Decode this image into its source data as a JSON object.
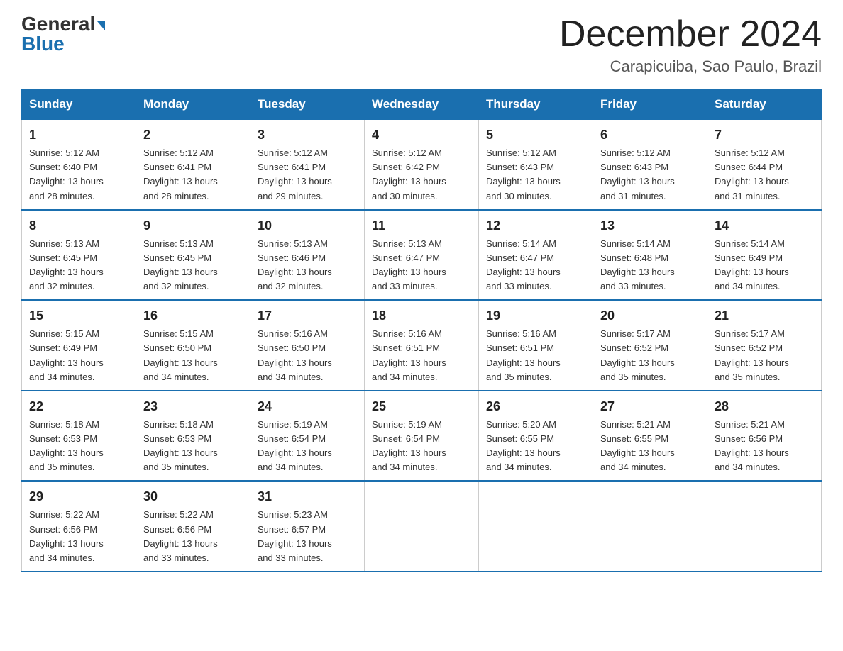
{
  "header": {
    "logo_general": "General",
    "logo_blue": "Blue",
    "title": "December 2024",
    "subtitle": "Carapicuiba, Sao Paulo, Brazil"
  },
  "weekdays": [
    "Sunday",
    "Monday",
    "Tuesday",
    "Wednesday",
    "Thursday",
    "Friday",
    "Saturday"
  ],
  "weeks": [
    [
      {
        "day": "1",
        "info": "Sunrise: 5:12 AM\nSunset: 6:40 PM\nDaylight: 13 hours\nand 28 minutes."
      },
      {
        "day": "2",
        "info": "Sunrise: 5:12 AM\nSunset: 6:41 PM\nDaylight: 13 hours\nand 28 minutes."
      },
      {
        "day": "3",
        "info": "Sunrise: 5:12 AM\nSunset: 6:41 PM\nDaylight: 13 hours\nand 29 minutes."
      },
      {
        "day": "4",
        "info": "Sunrise: 5:12 AM\nSunset: 6:42 PM\nDaylight: 13 hours\nand 30 minutes."
      },
      {
        "day": "5",
        "info": "Sunrise: 5:12 AM\nSunset: 6:43 PM\nDaylight: 13 hours\nand 30 minutes."
      },
      {
        "day": "6",
        "info": "Sunrise: 5:12 AM\nSunset: 6:43 PM\nDaylight: 13 hours\nand 31 minutes."
      },
      {
        "day": "7",
        "info": "Sunrise: 5:12 AM\nSunset: 6:44 PM\nDaylight: 13 hours\nand 31 minutes."
      }
    ],
    [
      {
        "day": "8",
        "info": "Sunrise: 5:13 AM\nSunset: 6:45 PM\nDaylight: 13 hours\nand 32 minutes."
      },
      {
        "day": "9",
        "info": "Sunrise: 5:13 AM\nSunset: 6:45 PM\nDaylight: 13 hours\nand 32 minutes."
      },
      {
        "day": "10",
        "info": "Sunrise: 5:13 AM\nSunset: 6:46 PM\nDaylight: 13 hours\nand 32 minutes."
      },
      {
        "day": "11",
        "info": "Sunrise: 5:13 AM\nSunset: 6:47 PM\nDaylight: 13 hours\nand 33 minutes."
      },
      {
        "day": "12",
        "info": "Sunrise: 5:14 AM\nSunset: 6:47 PM\nDaylight: 13 hours\nand 33 minutes."
      },
      {
        "day": "13",
        "info": "Sunrise: 5:14 AM\nSunset: 6:48 PM\nDaylight: 13 hours\nand 33 minutes."
      },
      {
        "day": "14",
        "info": "Sunrise: 5:14 AM\nSunset: 6:49 PM\nDaylight: 13 hours\nand 34 minutes."
      }
    ],
    [
      {
        "day": "15",
        "info": "Sunrise: 5:15 AM\nSunset: 6:49 PM\nDaylight: 13 hours\nand 34 minutes."
      },
      {
        "day": "16",
        "info": "Sunrise: 5:15 AM\nSunset: 6:50 PM\nDaylight: 13 hours\nand 34 minutes."
      },
      {
        "day": "17",
        "info": "Sunrise: 5:16 AM\nSunset: 6:50 PM\nDaylight: 13 hours\nand 34 minutes."
      },
      {
        "day": "18",
        "info": "Sunrise: 5:16 AM\nSunset: 6:51 PM\nDaylight: 13 hours\nand 34 minutes."
      },
      {
        "day": "19",
        "info": "Sunrise: 5:16 AM\nSunset: 6:51 PM\nDaylight: 13 hours\nand 35 minutes."
      },
      {
        "day": "20",
        "info": "Sunrise: 5:17 AM\nSunset: 6:52 PM\nDaylight: 13 hours\nand 35 minutes."
      },
      {
        "day": "21",
        "info": "Sunrise: 5:17 AM\nSunset: 6:52 PM\nDaylight: 13 hours\nand 35 minutes."
      }
    ],
    [
      {
        "day": "22",
        "info": "Sunrise: 5:18 AM\nSunset: 6:53 PM\nDaylight: 13 hours\nand 35 minutes."
      },
      {
        "day": "23",
        "info": "Sunrise: 5:18 AM\nSunset: 6:53 PM\nDaylight: 13 hours\nand 35 minutes."
      },
      {
        "day": "24",
        "info": "Sunrise: 5:19 AM\nSunset: 6:54 PM\nDaylight: 13 hours\nand 34 minutes."
      },
      {
        "day": "25",
        "info": "Sunrise: 5:19 AM\nSunset: 6:54 PM\nDaylight: 13 hours\nand 34 minutes."
      },
      {
        "day": "26",
        "info": "Sunrise: 5:20 AM\nSunset: 6:55 PM\nDaylight: 13 hours\nand 34 minutes."
      },
      {
        "day": "27",
        "info": "Sunrise: 5:21 AM\nSunset: 6:55 PM\nDaylight: 13 hours\nand 34 minutes."
      },
      {
        "day": "28",
        "info": "Sunrise: 5:21 AM\nSunset: 6:56 PM\nDaylight: 13 hours\nand 34 minutes."
      }
    ],
    [
      {
        "day": "29",
        "info": "Sunrise: 5:22 AM\nSunset: 6:56 PM\nDaylight: 13 hours\nand 34 minutes."
      },
      {
        "day": "30",
        "info": "Sunrise: 5:22 AM\nSunset: 6:56 PM\nDaylight: 13 hours\nand 33 minutes."
      },
      {
        "day": "31",
        "info": "Sunrise: 5:23 AM\nSunset: 6:57 PM\nDaylight: 13 hours\nand 33 minutes."
      },
      {
        "day": "",
        "info": ""
      },
      {
        "day": "",
        "info": ""
      },
      {
        "day": "",
        "info": ""
      },
      {
        "day": "",
        "info": ""
      }
    ]
  ]
}
